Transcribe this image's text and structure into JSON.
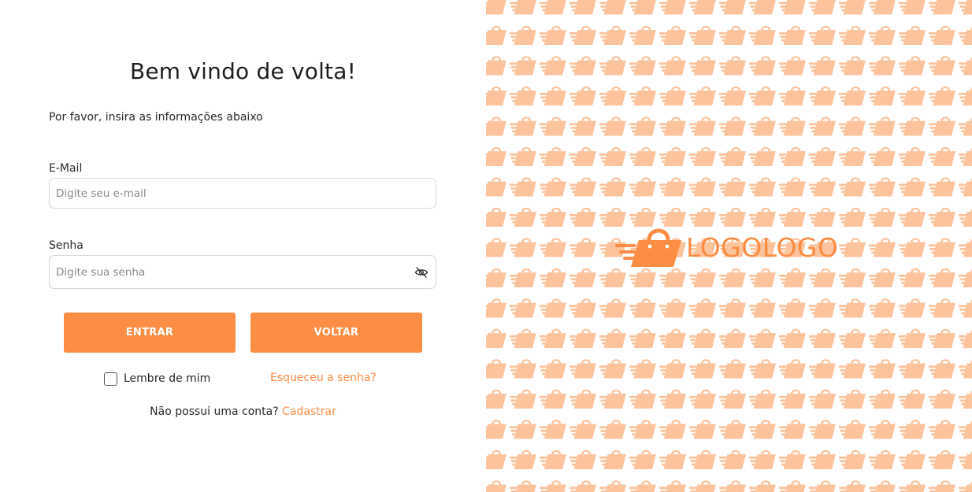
{
  "form": {
    "title": "Bem vindo de volta!",
    "subtitle": "Por favor, insira as informações abaixo",
    "email": {
      "label": "E-Mail",
      "value": "",
      "placeholder": "Digite seu e-mail"
    },
    "password": {
      "label": "Senha",
      "value": "",
      "placeholder": "Digite sua senha",
      "toggle_icon": "eye-off-icon"
    },
    "buttons": {
      "enter_label": "ENTRAR",
      "back_label": "VOLTAR"
    },
    "remember": {
      "label": "Lembre de mim",
      "checked": false
    },
    "forgot_label": "Esqueceu a senha?",
    "signup": {
      "prompt": "Não possui uma conta?",
      "link_label": "Cadastrar"
    }
  },
  "brand": {
    "logo_text": "LOGOLOGO",
    "logo_icon": "shopping-bag-icon",
    "pattern_icon": "shopping-bag-icon"
  },
  "colors": {
    "accent": "#fd8c44",
    "pattern": "#fcc39d",
    "text": "#1f1f1f",
    "border": "#d8d8d8"
  }
}
